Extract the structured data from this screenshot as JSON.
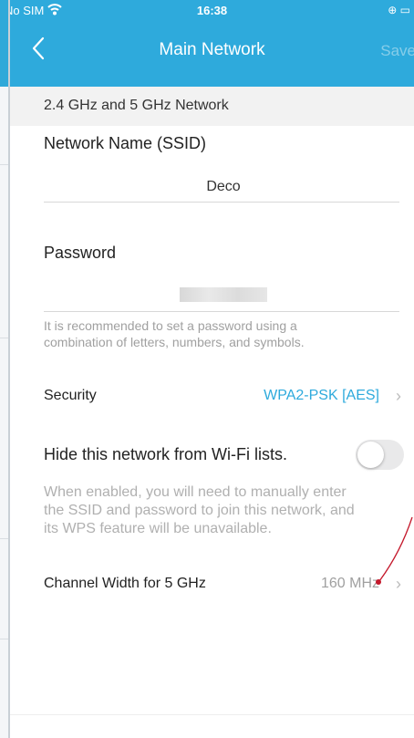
{
  "status_bar": {
    "carrier": "No SIM",
    "time": "16:38",
    "right_icons": "⊕ ▭"
  },
  "nav": {
    "title": "Main Network",
    "save_label": "Save"
  },
  "section": {
    "title": "2.4 GHz and 5 GHz Network"
  },
  "ssid": {
    "label": "Network Name (SSID)",
    "value": "Deco"
  },
  "password": {
    "label": "Password",
    "hint_line1": "It is recommended to set a password using a",
    "hint_line2": "combination of letters, numbers, and symbols."
  },
  "security": {
    "label": "Security",
    "value": "WPA2-PSK [AES]"
  },
  "hide_network": {
    "label": "Hide this network from Wi-Fi lists.",
    "enabled": false,
    "hint_line1": "When enabled, you will need to manually enter",
    "hint_line2": "the SSID and password to join this network, and",
    "hint_line3": "its WPS feature will be unavailable."
  },
  "channel_width": {
    "label": "Channel Width for 5 GHz",
    "value": "160 MHz"
  },
  "colors": {
    "header": "#2eaadc",
    "accent": "#2eaadc",
    "muted": "#a0a0a0",
    "annotation": "#c4182b"
  },
  "icons": {
    "back": "chevron-left-icon",
    "wifi": "wifi-icon",
    "chevron": "chevron-right-icon"
  }
}
